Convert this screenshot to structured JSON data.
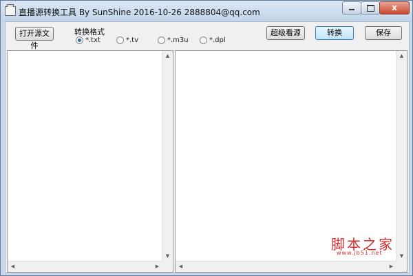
{
  "window": {
    "title": "直播源转换工具 By SunShine 2016-10-26 2888804@qq.com",
    "close_glyph": "x"
  },
  "toolbar": {
    "open_source_label": "打开源文件",
    "format_label": "转换格式",
    "formats": [
      {
        "label": "*.txt",
        "selected": true
      },
      {
        "label": "*.tv",
        "selected": false
      },
      {
        "label": "*.m3u",
        "selected": false
      },
      {
        "label": "*.dpl",
        "selected": false
      }
    ],
    "super_source_label": "超级看源",
    "convert_label": "转换",
    "save_label": "保存"
  },
  "scroll_arrows": {
    "up": "▲",
    "down": "▼",
    "left": "◀",
    "right": "▶"
  },
  "watermark": {
    "site_name": "脚本之家",
    "url": "www.jb51.net"
  }
}
